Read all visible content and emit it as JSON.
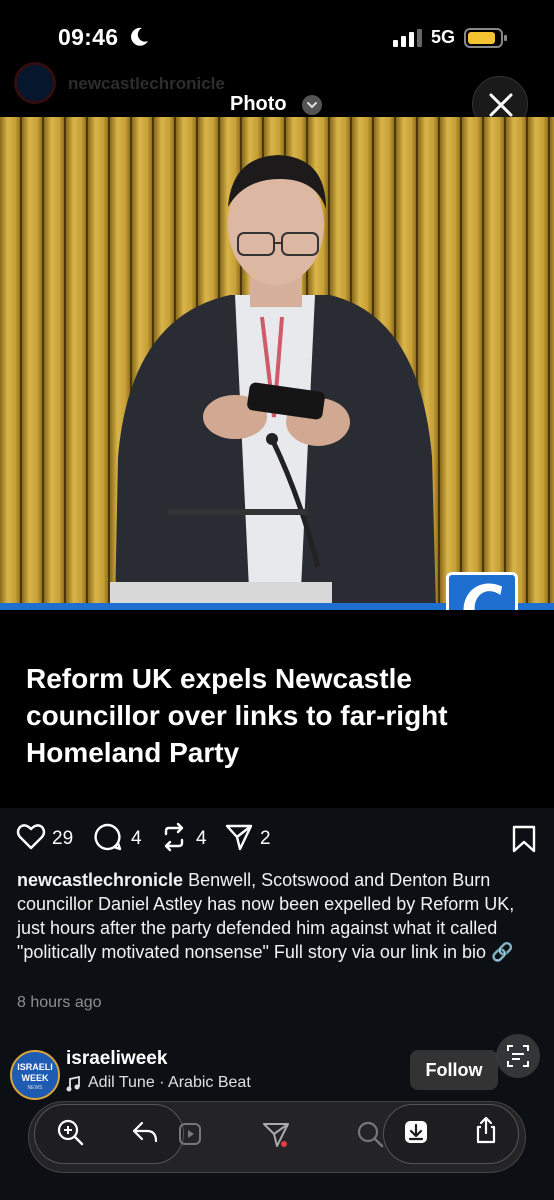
{
  "status_bar": {
    "time": "09:46",
    "network": "5G",
    "icons": [
      "moon-icon",
      "cellular-signal-icon",
      "battery-icon"
    ],
    "battery_color": "#f4c430"
  },
  "header": {
    "faded_handle": "newcastlechronicle",
    "title": "Photo",
    "icons": [
      "chevron-down-icon",
      "close-icon"
    ]
  },
  "photo": {
    "brand_logo_letter": "C",
    "brand_color": "#1f6fd0"
  },
  "headline": "Reform UK expels Newcastle councillor over links to far-right Homeland Party",
  "post": {
    "likes": "29",
    "comments": "4",
    "reposts": "4",
    "shares": "2",
    "icons": [
      "heart-icon",
      "comment-icon",
      "repost-icon",
      "send-icon",
      "bookmark-icon"
    ],
    "caption_handle": "newcastlechronicle",
    "caption_text": " Benwell, Scotswood and Denton Burn councillor Daniel Astley has now been expelled by Reform UK, just hours after the party defended him against what it called \"politically motivated nonsense\" Full story via our link in bio 🔗",
    "timestamp": "8 hours ago"
  },
  "next_post": {
    "avatar_line1": "ISRAELI",
    "avatar_line2": "WEEK",
    "avatar_line3": "NEWS",
    "handle": "israeliweek",
    "audio": "Adil Tune · Arabic Beat",
    "follow_label": "Follow"
  },
  "toolbar": {
    "icons": [
      "zoom-in-icon",
      "reply-icon",
      "send-icon",
      "search-icon",
      "download-icon",
      "share-icon"
    ]
  }
}
